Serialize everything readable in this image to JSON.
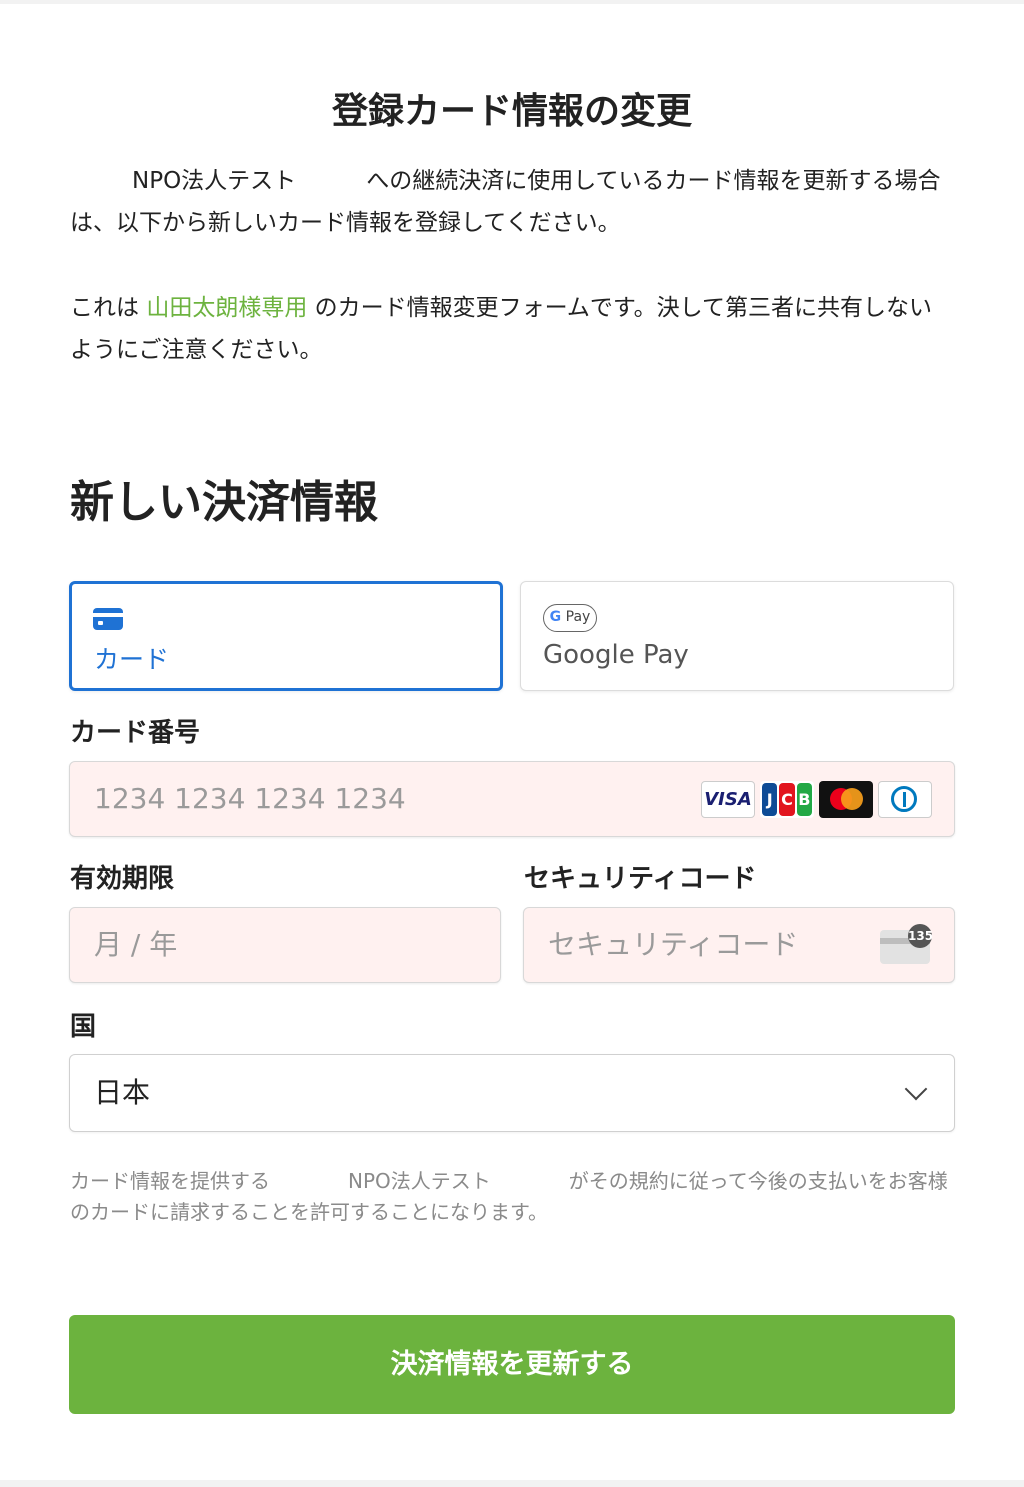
{
  "header": {
    "title": "登録カード情報の変更"
  },
  "intro": {
    "org_name": "NPO法人テスト",
    "text1": "への継続決済に使用しているカード情報を更新する場合は、以下から新しいカード情報を登録してください。",
    "text2_prefix": "これは",
    "customer_name": "山田太朗様専用",
    "text2_suffix": "のカード情報変更フォームです。決して第三者に共有しないようにご注意ください。"
  },
  "payment": {
    "section_title": "新しい決済情報",
    "tabs": [
      {
        "label": "カード",
        "icon": "credit-card-icon",
        "selected": true
      },
      {
        "label": "Google Pay",
        "icon": "google-pay-icon",
        "badge": "Pay",
        "selected": false
      }
    ],
    "card_number": {
      "label": "カード番号",
      "placeholder": "1234 1234 1234 1234",
      "brands": [
        "VISA",
        "JCB",
        "Mastercard",
        "Diners"
      ]
    },
    "expiry": {
      "label": "有効期限",
      "placeholder": "月 / 年"
    },
    "cvc": {
      "label": "セキュリティコード",
      "placeholder": "セキュリティコード",
      "icon_number": "135"
    },
    "country": {
      "label": "国",
      "value": "日本"
    }
  },
  "consent": {
    "prefix": "カード情報を提供する",
    "org_name": "NPO法人テスト",
    "suffix": "がその規約に従って今後の支払いをお客様のカードに請求することを許可することになります。"
  },
  "submit": {
    "label": "決済情報を更新する"
  },
  "colors": {
    "accent_blue": "#1f72d4",
    "link_green": "#6db33f",
    "button_green": "#6cb33e",
    "input_bg": "#fff1f0"
  }
}
